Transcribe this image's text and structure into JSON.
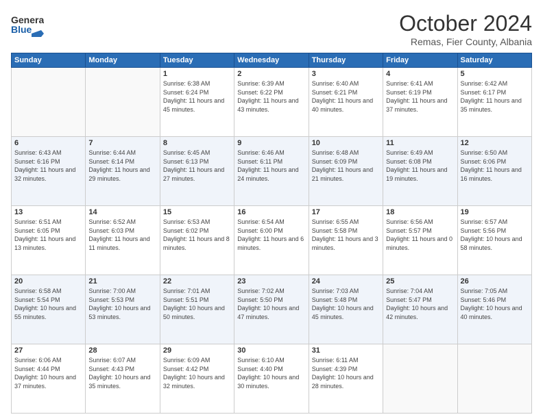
{
  "header": {
    "logo_line1": "General",
    "logo_line2": "Blue",
    "month_title": "October 2024",
    "subtitle": "Remas, Fier County, Albania"
  },
  "days_of_week": [
    "Sunday",
    "Monday",
    "Tuesday",
    "Wednesday",
    "Thursday",
    "Friday",
    "Saturday"
  ],
  "weeks": [
    [
      {
        "day": "",
        "info": ""
      },
      {
        "day": "",
        "info": ""
      },
      {
        "day": "1",
        "info": "Sunrise: 6:38 AM\nSunset: 6:24 PM\nDaylight: 11 hours and 45 minutes."
      },
      {
        "day": "2",
        "info": "Sunrise: 6:39 AM\nSunset: 6:22 PM\nDaylight: 11 hours and 43 minutes."
      },
      {
        "day": "3",
        "info": "Sunrise: 6:40 AM\nSunset: 6:21 PM\nDaylight: 11 hours and 40 minutes."
      },
      {
        "day": "4",
        "info": "Sunrise: 6:41 AM\nSunset: 6:19 PM\nDaylight: 11 hours and 37 minutes."
      },
      {
        "day": "5",
        "info": "Sunrise: 6:42 AM\nSunset: 6:17 PM\nDaylight: 11 hours and 35 minutes."
      }
    ],
    [
      {
        "day": "6",
        "info": "Sunrise: 6:43 AM\nSunset: 6:16 PM\nDaylight: 11 hours and 32 minutes."
      },
      {
        "day": "7",
        "info": "Sunrise: 6:44 AM\nSunset: 6:14 PM\nDaylight: 11 hours and 29 minutes."
      },
      {
        "day": "8",
        "info": "Sunrise: 6:45 AM\nSunset: 6:13 PM\nDaylight: 11 hours and 27 minutes."
      },
      {
        "day": "9",
        "info": "Sunrise: 6:46 AM\nSunset: 6:11 PM\nDaylight: 11 hours and 24 minutes."
      },
      {
        "day": "10",
        "info": "Sunrise: 6:48 AM\nSunset: 6:09 PM\nDaylight: 11 hours and 21 minutes."
      },
      {
        "day": "11",
        "info": "Sunrise: 6:49 AM\nSunset: 6:08 PM\nDaylight: 11 hours and 19 minutes."
      },
      {
        "day": "12",
        "info": "Sunrise: 6:50 AM\nSunset: 6:06 PM\nDaylight: 11 hours and 16 minutes."
      }
    ],
    [
      {
        "day": "13",
        "info": "Sunrise: 6:51 AM\nSunset: 6:05 PM\nDaylight: 11 hours and 13 minutes."
      },
      {
        "day": "14",
        "info": "Sunrise: 6:52 AM\nSunset: 6:03 PM\nDaylight: 11 hours and 11 minutes."
      },
      {
        "day": "15",
        "info": "Sunrise: 6:53 AM\nSunset: 6:02 PM\nDaylight: 11 hours and 8 minutes."
      },
      {
        "day": "16",
        "info": "Sunrise: 6:54 AM\nSunset: 6:00 PM\nDaylight: 11 hours and 6 minutes."
      },
      {
        "day": "17",
        "info": "Sunrise: 6:55 AM\nSunset: 5:58 PM\nDaylight: 11 hours and 3 minutes."
      },
      {
        "day": "18",
        "info": "Sunrise: 6:56 AM\nSunset: 5:57 PM\nDaylight: 11 hours and 0 minutes."
      },
      {
        "day": "19",
        "info": "Sunrise: 6:57 AM\nSunset: 5:56 PM\nDaylight: 10 hours and 58 minutes."
      }
    ],
    [
      {
        "day": "20",
        "info": "Sunrise: 6:58 AM\nSunset: 5:54 PM\nDaylight: 10 hours and 55 minutes."
      },
      {
        "day": "21",
        "info": "Sunrise: 7:00 AM\nSunset: 5:53 PM\nDaylight: 10 hours and 53 minutes."
      },
      {
        "day": "22",
        "info": "Sunrise: 7:01 AM\nSunset: 5:51 PM\nDaylight: 10 hours and 50 minutes."
      },
      {
        "day": "23",
        "info": "Sunrise: 7:02 AM\nSunset: 5:50 PM\nDaylight: 10 hours and 47 minutes."
      },
      {
        "day": "24",
        "info": "Sunrise: 7:03 AM\nSunset: 5:48 PM\nDaylight: 10 hours and 45 minutes."
      },
      {
        "day": "25",
        "info": "Sunrise: 7:04 AM\nSunset: 5:47 PM\nDaylight: 10 hours and 42 minutes."
      },
      {
        "day": "26",
        "info": "Sunrise: 7:05 AM\nSunset: 5:46 PM\nDaylight: 10 hours and 40 minutes."
      }
    ],
    [
      {
        "day": "27",
        "info": "Sunrise: 6:06 AM\nSunset: 4:44 PM\nDaylight: 10 hours and 37 minutes."
      },
      {
        "day": "28",
        "info": "Sunrise: 6:07 AM\nSunset: 4:43 PM\nDaylight: 10 hours and 35 minutes."
      },
      {
        "day": "29",
        "info": "Sunrise: 6:09 AM\nSunset: 4:42 PM\nDaylight: 10 hours and 32 minutes."
      },
      {
        "day": "30",
        "info": "Sunrise: 6:10 AM\nSunset: 4:40 PM\nDaylight: 10 hours and 30 minutes."
      },
      {
        "day": "31",
        "info": "Sunrise: 6:11 AM\nSunset: 4:39 PM\nDaylight: 10 hours and 28 minutes."
      },
      {
        "day": "",
        "info": ""
      },
      {
        "day": "",
        "info": ""
      }
    ]
  ]
}
